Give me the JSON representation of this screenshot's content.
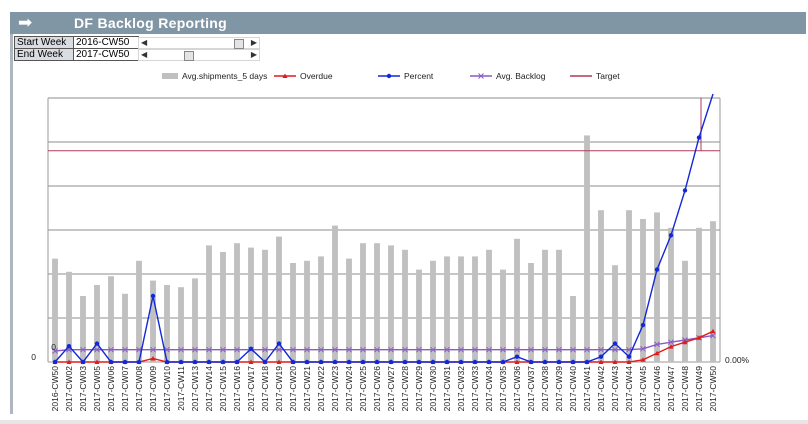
{
  "header": {
    "title": "DF Backlog  Reporting",
    "arrow_icon": "right-arrow-icon"
  },
  "filters": {
    "start_week": {
      "label": "Start Week",
      "value": "2016-CW50",
      "position": 0.86
    },
    "end_week": {
      "label": "End Week",
      "value": "2017-CW50",
      "position": 0.34
    }
  },
  "colors": {
    "bars": "#c0c0c0",
    "overdue": "#e01b1b",
    "percent": "#1328d6",
    "avg_backlog": "#8a5cc4",
    "target": "#b03a5a",
    "grid": "#8c8c8c"
  },
  "chart_data": {
    "type": "bar",
    "legend_position": "top",
    "grid": true,
    "categories": [
      "2016-CW50",
      "2017-CW02",
      "2017-CW03",
      "2017-CW05",
      "2017-CW06",
      "2017-CW07",
      "2017-CW08",
      "2017-CW09",
      "2017-CW10",
      "2017-CW11",
      "2017-CW13",
      "2017-CW14",
      "2017-CW15",
      "2017-CW16",
      "2017-CW17",
      "2017-CW18",
      "2017-CW19",
      "2017-CW20",
      "2017-CW21",
      "2017-CW22",
      "2017-CW23",
      "2017-CW24",
      "2017-CW25",
      "2017-CW26",
      "2017-CW27",
      "2017-CW28",
      "2017-CW29",
      "2017-CW30",
      "2017-CW31",
      "2017-CW32",
      "2017-CW33",
      "2017-CW34",
      "2017-CW35",
      "2017-CW36",
      "2017-CW37",
      "2017-CW38",
      "2017-CW39",
      "2017-CW40",
      "2017-CW41",
      "2017-CW42",
      "2017-CW43",
      "2017-CW44",
      "2017-CW45",
      "2017-CW46",
      "2017-CW47",
      "2017-CW48",
      "2017-CW49",
      "2017-CW50"
    ],
    "y_left": {
      "ylim": [
        0,
        600
      ],
      "tick_labels": [
        "0",
        "0"
      ]
    },
    "y_right": {
      "ylim": [
        0,
        1
      ],
      "tick_labels": [
        "0.00%"
      ]
    },
    "series": [
      {
        "name": "Avg.shipments_5 days",
        "kind": "bar",
        "axis": "left",
        "values": [
          235,
          205,
          150,
          175,
          195,
          155,
          230,
          185,
          175,
          170,
          190,
          265,
          250,
          270,
          260,
          255,
          285,
          225,
          230,
          240,
          310,
          235,
          270,
          270,
          265,
          255,
          210,
          230,
          240,
          240,
          240,
          255,
          210,
          280,
          225,
          255,
          255,
          150,
          515,
          345,
          220,
          345,
          325,
          340,
          305,
          230,
          305,
          320
        ]
      },
      {
        "name": "Overdue",
        "kind": "line",
        "axis": "left",
        "values": [
          0,
          0,
          0,
          0,
          0,
          0,
          0,
          8,
          0,
          0,
          0,
          0,
          0,
          0,
          0,
          0,
          0,
          0,
          0,
          0,
          0,
          0,
          0,
          0,
          0,
          0,
          0,
          0,
          0,
          0,
          0,
          0,
          0,
          0,
          0,
          0,
          0,
          0,
          0,
          0,
          0,
          0,
          5,
          20,
          35,
          45,
          55,
          70
        ]
      },
      {
        "name": "Percent",
        "kind": "line",
        "axis": "right",
        "values": [
          0.0,
          0.06,
          0.0,
          0.07,
          0.0,
          0.0,
          0.0,
          0.25,
          0.0,
          0.0,
          0.0,
          0.0,
          0.0,
          0.0,
          0.05,
          0.0,
          0.07,
          0.0,
          0.0,
          0.0,
          0.0,
          0.0,
          0.0,
          0.0,
          0.0,
          0.0,
          0.0,
          0.0,
          0.0,
          0.0,
          0.0,
          0.0,
          0.0,
          0.02,
          0.0,
          0.0,
          0.0,
          0.0,
          0.0,
          0.02,
          0.07,
          0.02,
          0.14,
          0.35,
          0.48,
          0.65,
          0.85,
          1.2
        ]
      },
      {
        "name": "Avg. Backlog",
        "kind": "line",
        "axis": "left",
        "values": [
          25,
          28,
          28,
          28,
          28,
          28,
          28,
          28,
          28,
          28,
          28,
          28,
          28,
          28,
          28,
          28,
          28,
          28,
          28,
          28,
          28,
          28,
          28,
          28,
          28,
          28,
          28,
          28,
          28,
          28,
          28,
          28,
          28,
          28,
          28,
          28,
          28,
          28,
          28,
          28,
          28,
          28,
          30,
          40,
          45,
          50,
          55,
          60
        ]
      },
      {
        "name": "Target",
        "kind": "line",
        "axis": "right",
        "values": [
          0.8,
          0.8,
          0.8,
          0.8,
          0.8,
          0.8,
          0.8,
          0.8,
          0.8,
          0.8,
          0.8,
          0.8,
          0.8,
          0.8,
          0.8,
          0.8,
          0.8,
          0.8,
          0.8,
          0.8,
          0.8,
          0.8,
          0.8,
          0.8,
          0.8,
          0.8,
          0.8,
          0.8,
          0.8,
          0.8,
          0.8,
          0.8,
          0.8,
          0.8,
          0.8,
          0.8,
          0.8,
          0.8,
          0.8,
          0.8,
          0.8,
          0.8,
          0.8,
          0.8,
          0.8,
          0.8,
          0.8,
          0.8
        ]
      }
    ]
  }
}
